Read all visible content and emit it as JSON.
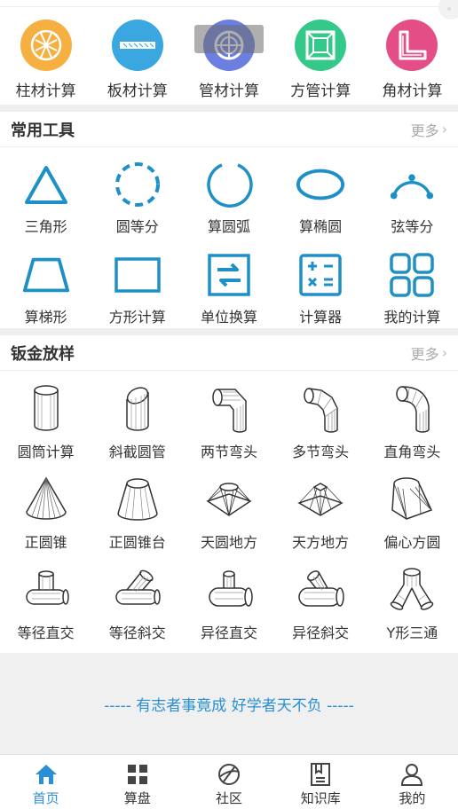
{
  "categories": [
    {
      "label": "柱材计算",
      "icon": "column-icon",
      "color": "#f5a623"
    },
    {
      "label": "板材计算",
      "icon": "plate-icon",
      "color": "#2a9fd8"
    },
    {
      "label": "管材计算",
      "icon": "pipe-icon",
      "color": "#5b6fd6"
    },
    {
      "label": "方管计算",
      "icon": "square-tube-icon",
      "color": "#2ec27e"
    },
    {
      "label": "角材计算",
      "icon": "angle-icon",
      "color": "#e0457b"
    }
  ],
  "common_tools": {
    "title": "常用工具",
    "more": "更多",
    "items": [
      {
        "label": "三角形",
        "icon": "triangle-icon"
      },
      {
        "label": "圆等分",
        "icon": "circle-divide-icon"
      },
      {
        "label": "算圆弧",
        "icon": "arc-icon"
      },
      {
        "label": "算椭圆",
        "icon": "ellipse-icon"
      },
      {
        "label": "弦等分",
        "icon": "chord-divide-icon"
      },
      {
        "label": "算梯形",
        "icon": "trapezoid-icon"
      },
      {
        "label": "方形计算",
        "icon": "rectangle-icon"
      },
      {
        "label": "单位换算",
        "icon": "unit-convert-icon"
      },
      {
        "label": "计算器",
        "icon": "calculator-icon"
      },
      {
        "label": "我的计算",
        "icon": "my-calc-icon"
      }
    ]
  },
  "sheet_metal": {
    "title": "钣金放样",
    "more": "更多",
    "items": [
      {
        "label": "圆筒计算",
        "icon": "cylinder-icon"
      },
      {
        "label": "斜截圆管",
        "icon": "oblique-pipe-icon"
      },
      {
        "label": "两节弯头",
        "icon": "two-section-elbow-icon"
      },
      {
        "label": "多节弯头",
        "icon": "multi-section-elbow-icon"
      },
      {
        "label": "直角弯头",
        "icon": "right-angle-elbow-icon"
      },
      {
        "label": "正圆锥",
        "icon": "cone-icon"
      },
      {
        "label": "正圆锥台",
        "icon": "frustum-icon"
      },
      {
        "label": "天圆地方",
        "icon": "round-to-square-icon"
      },
      {
        "label": "天方地方",
        "icon": "square-to-square-icon"
      },
      {
        "label": "偏心方圆",
        "icon": "eccentric-transition-icon"
      },
      {
        "label": "等径直交",
        "icon": "equal-tee-icon"
      },
      {
        "label": "等径斜交",
        "icon": "equal-oblique-tee-icon"
      },
      {
        "label": "异径直交",
        "icon": "reducing-tee-icon"
      },
      {
        "label": "异径斜交",
        "icon": "reducing-oblique-tee-icon"
      },
      {
        "label": "Y形三通",
        "icon": "y-branch-icon"
      }
    ]
  },
  "motto": "----- 有志者事竟成 好学者天不负 -----",
  "tabbar": [
    {
      "label": "首页",
      "icon": "home-icon",
      "active": true
    },
    {
      "label": "算盘",
      "icon": "grid-icon",
      "active": false
    },
    {
      "label": "社区",
      "icon": "community-icon",
      "active": false
    },
    {
      "label": "知识库",
      "icon": "book-icon",
      "active": false
    },
    {
      "label": "我的",
      "icon": "user-icon",
      "active": false
    }
  ],
  "colors": {
    "accent": "#2a8fd4",
    "tool_stroke": "#1e90c8",
    "gap": "#eeeeee"
  }
}
